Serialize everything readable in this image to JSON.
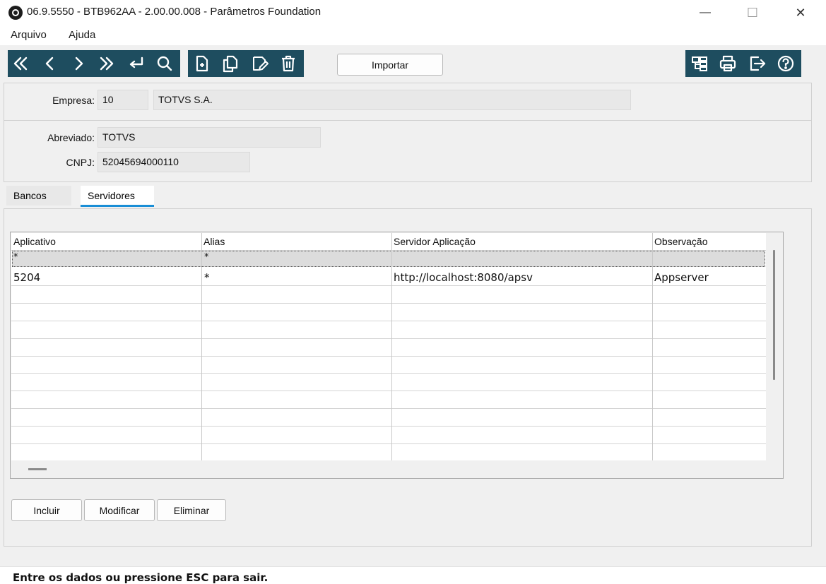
{
  "window": {
    "title": "06.9.5550 - BTB962AA - 2.00.00.008 - Parâmetros Foundation",
    "minimize": "—",
    "maximize": "☐",
    "close": "✕"
  },
  "menu": {
    "items": [
      "Arquivo",
      "Ajuda"
    ]
  },
  "toolbar": {
    "nav_icons": [
      "first-icon",
      "previous-icon",
      "next-icon",
      "last-icon",
      "goto-icon",
      "search-icon"
    ],
    "edit_icons": [
      "new-icon",
      "copy-icon",
      "edit-icon",
      "delete-icon"
    ],
    "right_icons": [
      "structure-icon",
      "print-icon",
      "exit-icon",
      "help-icon"
    ],
    "import_label": "Importar",
    "accent_color": "#1e4d5f"
  },
  "form": {
    "empresa_label": "Empresa:",
    "empresa_code": "10",
    "empresa_name": "TOTVS S.A.",
    "abreviado_label": "Abreviado:",
    "abreviado_value": "TOTVS",
    "cnpj_label": "CNPJ:",
    "cnpj_value": "52045694000110"
  },
  "tabs": {
    "items": [
      "Bancos",
      "Servidores"
    ],
    "active": "Servidores"
  },
  "grid": {
    "columns": [
      "Aplicativo",
      "Alias",
      "Servidor Aplicação",
      "Observação"
    ],
    "filter_row": [
      "*",
      "*",
      "",
      ""
    ],
    "rows": [
      [
        "5204",
        "*",
        "http://localhost:8080/apsv",
        "Appserver"
      ]
    ]
  },
  "buttons": {
    "incluir": "Incluir",
    "modificar": "Modificar",
    "eliminar": "Eliminar"
  },
  "status": {
    "message": "Entre os dados ou pressione ESC para sair."
  }
}
